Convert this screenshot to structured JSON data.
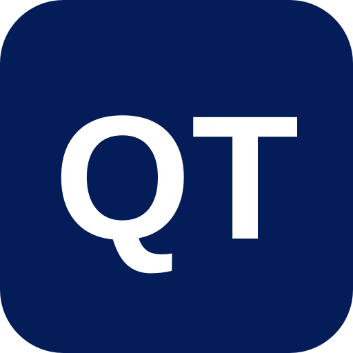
{
  "app_icon": {
    "monogram": "QT",
    "background_color": "#041c57",
    "text_color": "#ffffff"
  }
}
